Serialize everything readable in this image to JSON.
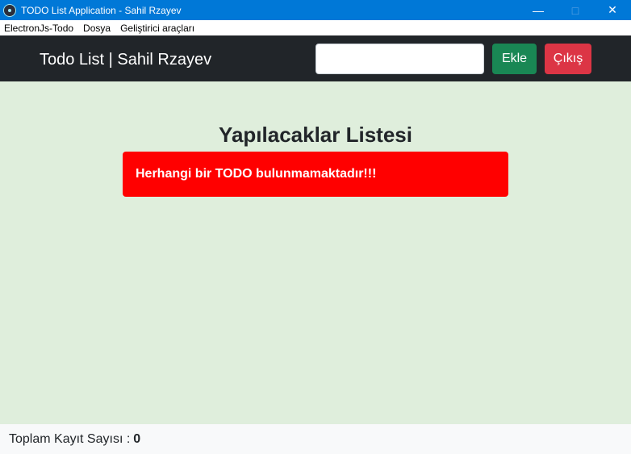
{
  "window": {
    "title": "TODO List Application - Sahil Rzayev",
    "controls": [
      "minimize-icon",
      "maximize-icon",
      "close-icon"
    ]
  },
  "menubar": {
    "items": [
      {
        "label": "ElectronJs-Todo"
      },
      {
        "label": "Dosya"
      },
      {
        "label": "Geliştirici araçları"
      }
    ]
  },
  "navbar": {
    "brand": "Todo List | Sahil Rzayev",
    "input_value": "",
    "add_label": "Ekle",
    "exit_label": "Çıkış"
  },
  "main": {
    "title": "Yapılacaklar Listesi",
    "empty_message": "Herhangi bir TODO bulunmamaktadır!!!"
  },
  "footer": {
    "label": "Toplam Kayıt Sayısı :",
    "count": "0"
  },
  "colors": {
    "titlebar": "#0078d7",
    "navbar": "#212529",
    "add_button": "#198754",
    "exit_button": "#dc3545",
    "background": "#dfeedc",
    "alert": "#ff0000"
  }
}
